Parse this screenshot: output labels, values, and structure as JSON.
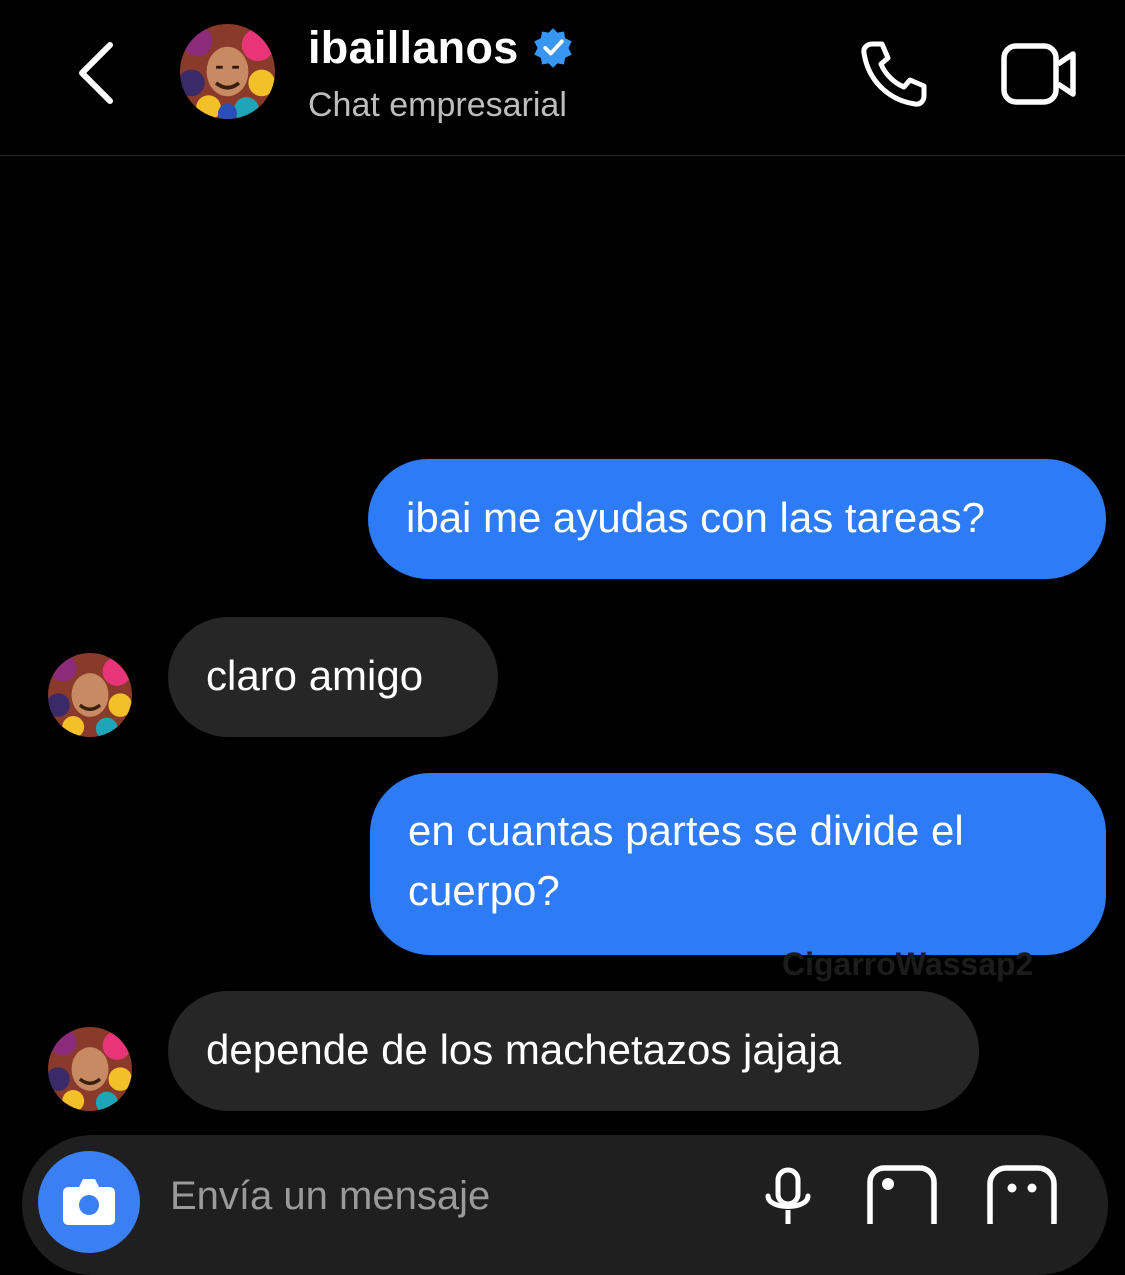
{
  "header": {
    "username": "ibaillanos",
    "subtitle": "Chat empresarial",
    "verified": true
  },
  "messages": [
    {
      "side": "sent",
      "text": "ibai me ayudas con las tareas?"
    },
    {
      "side": "received",
      "text": "claro amigo"
    },
    {
      "side": "sent",
      "text": "en cuantas partes se divide el cuerpo?"
    },
    {
      "side": "received",
      "text": "depende de los machetazos jajaja"
    }
  ],
  "watermark": "CigarroWassap2",
  "composer": {
    "placeholder": "Envía un mensaje"
  },
  "icons": {
    "back": "chevron-left-icon",
    "call": "phone-icon",
    "video": "video-camera-icon",
    "camera": "camera-icon",
    "mic": "microphone-icon",
    "gallery": "image-icon",
    "sticker": "sticker-icon"
  },
  "colors": {
    "background": "#000000",
    "sent_bubble": "#2e7bf6",
    "received_bubble": "#262626",
    "verified_badge": "#3897f0"
  }
}
